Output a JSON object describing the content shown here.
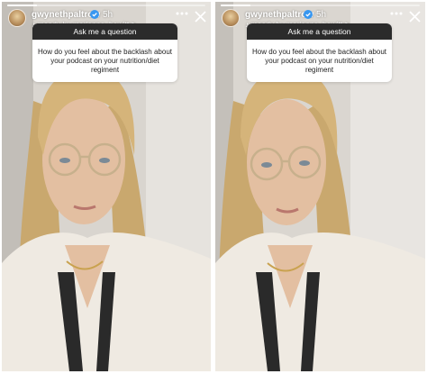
{
  "stories": [
    {
      "username": "gwynethpaltrow",
      "time": "5h",
      "music_title": "moody",
      "music_separator": "by",
      "music_artist": "marianna_hewitt",
      "music_chevron": ">",
      "question_header": "Ask me a question",
      "question_text": "How do you feel about the backlash about your podcast on your nutrition/diet regiment",
      "progress": 0.15
    },
    {
      "username": "gwynethpaltrow",
      "time": "5h",
      "music_title": "moody",
      "music_separator": "by",
      "music_artist": "marianna_hewitt",
      "music_chevron": ">",
      "question_header": "Ask me a question",
      "question_text": "How do you feel about the backlash about your podcast on your nutrition/diet regiment",
      "progress": 0.15
    }
  ],
  "icons": {
    "verified": "verified-badge-icon",
    "music": "music-note-icon",
    "more": "more-options-icon",
    "close": "close-icon"
  },
  "colors": {
    "verified": "#3897f0",
    "question_header_bg": "#2b2b2b",
    "card_bg": "#ffffff",
    "hair": "#d5b47a",
    "sweater": "#f1ede6",
    "skin": "#e3bfa1"
  }
}
